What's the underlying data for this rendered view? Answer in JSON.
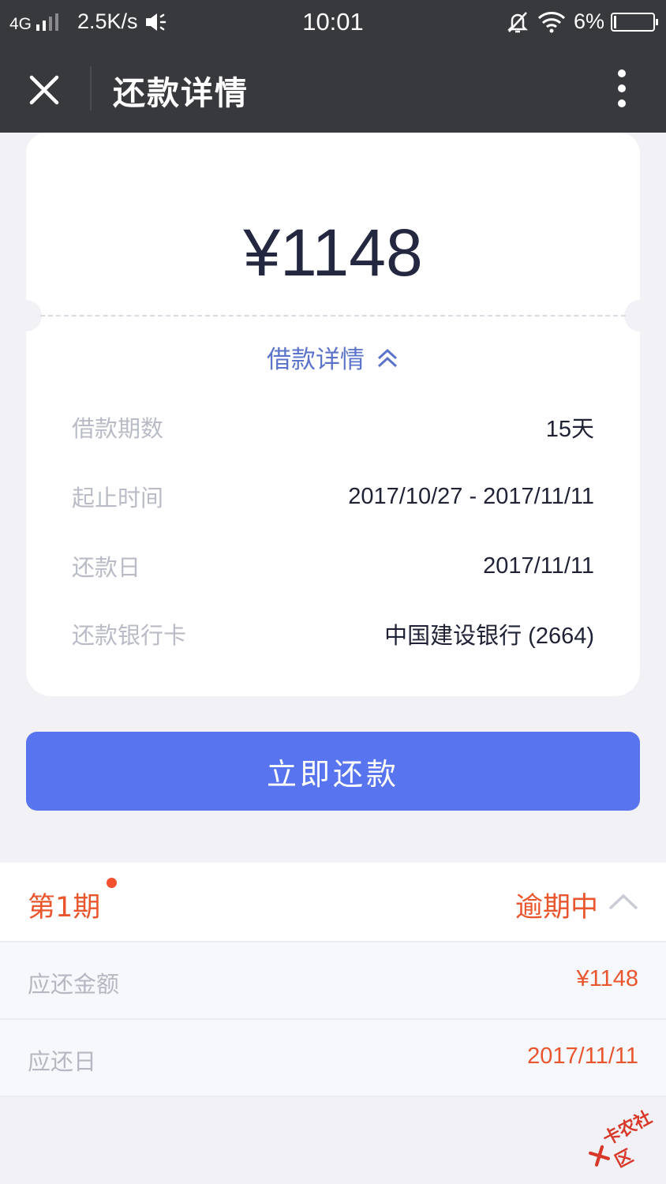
{
  "status_bar": {
    "network": "4G",
    "speed": "2.5K/s",
    "time": "10:01",
    "battery": "6%"
  },
  "title_bar": {
    "title": "还款详情"
  },
  "summary": {
    "amount": "¥1148",
    "loan_details_toggle": "借款详情"
  },
  "details": [
    {
      "label": "借款期数",
      "value": "15天"
    },
    {
      "label": "起止时间",
      "value": "2017/10/27 - 2017/11/11"
    },
    {
      "label": "还款日",
      "value": "2017/11/11"
    },
    {
      "label": "还款银行卡",
      "value": "中国建设银行 (2664)"
    }
  ],
  "pay_button": "立即还款",
  "installment": {
    "label": "第1期",
    "status": "逾期中",
    "rows": [
      {
        "label": "应还金额",
        "value": "¥1148"
      },
      {
        "label": "应还日",
        "value": "2017/11/11"
      }
    ]
  },
  "watermark": "卡农社区",
  "colors": {
    "header_bg": "#38393d",
    "primary": "#5874ee",
    "link": "#5b73c9",
    "warning": "#e9562d",
    "page_bg": "#f2f2f6"
  },
  "icons": [
    "signal-icon",
    "speaker-icon",
    "bell-off-icon",
    "wifi-icon",
    "battery-icon",
    "close-icon",
    "more-vertical-icon",
    "double-chevron-up-icon",
    "chevron-up-icon"
  ]
}
